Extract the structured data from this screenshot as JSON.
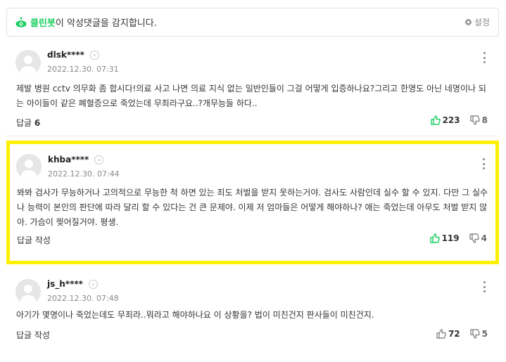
{
  "cleanbot": {
    "brand": "클린봇",
    "text": "이 악성댓글을 감지합니다.",
    "settings_label": "설정"
  },
  "colors": {
    "brand_green": "#19ce60",
    "highlight_border": "#fdf100",
    "upvote_active": "#19ce60",
    "upvote_inactive": "#888888"
  },
  "comments": [
    {
      "nickname": "dlsk****",
      "date": "2022.12.30. 07:31",
      "text": "제발 병원 cctv 의무화 좀 합시다!의료 사고 나면 의료 지식 없는 일반인들이 그걸 어떻게 입증하나요?그리고 한명도 아닌 네명이나 되는 아이들이 같은 폐혈증으로 죽었는데 무죄라구요..?개무능들 하다..",
      "reply_label": "답글",
      "reply_count": "6",
      "upvotes": "223",
      "downvotes": "8"
    },
    {
      "nickname": "khba****",
      "date": "2022.12.30. 07:44",
      "text": "봐봐 검사가 무능하거나 고의적으로 무능한 척 하면 있는 죄도 처벌을 받지 못하는거야. 검사도 사람인데 실수 할 수 있지. 다만 그 실수나 능력이 본인의 판단에 따라 달리 할 수 있다는 건 큰 문제야. 이제 저 엄마들은 어떻게 해야하나? 애는 죽었는데 아무도 처벌 받지 않아. 가슴이 찢어질거야. 평생.",
      "reply_label": "답글 작성",
      "reply_count": "",
      "upvotes": "119",
      "downvotes": "4"
    },
    {
      "nickname": "js_h****",
      "date": "2022.12.30. 07:48",
      "text": "아기가 몇명이나 죽었는데도 무죄라..뭐라고 해야하나요 이 상황을? 법이 미친건지 판사들이 미친건지.",
      "reply_label": "답글 작성",
      "reply_count": "",
      "upvotes": "72",
      "downvotes": "5"
    }
  ]
}
